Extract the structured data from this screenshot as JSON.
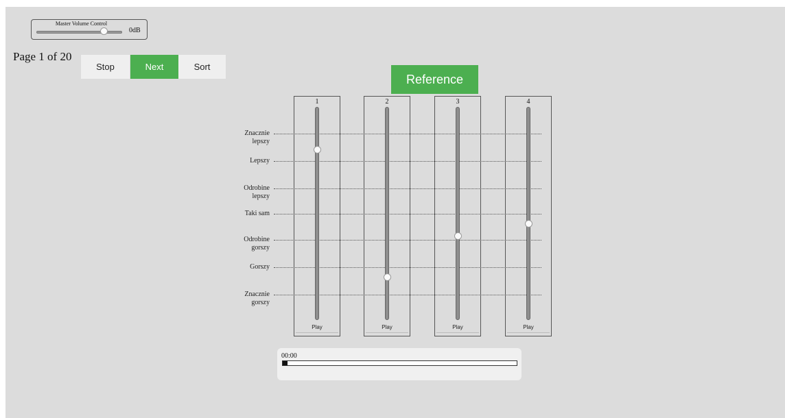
{
  "master_volume": {
    "title": "Master Volume Control",
    "value_label": "0dB",
    "level": 0.8
  },
  "pagination": {
    "label": "Page 1 of 20"
  },
  "buttons": {
    "stop": "Stop",
    "next": "Next",
    "sort": "Sort",
    "reference": "Reference"
  },
  "colors": {
    "accent": "#4caf50",
    "background": "#dcdcdc"
  },
  "scale_labels": [
    "Znacznie lepszy",
    "Lepszy",
    "Odrobine lepszy",
    "Taki sam",
    "Odrobine gorszy",
    "Gorszy",
    "Znacznie gorszy"
  ],
  "sliders": [
    {
      "number": "1",
      "play_label": "Play",
      "value": 0.81
    },
    {
      "number": "2",
      "play_label": "Play",
      "value": 0.19
    },
    {
      "number": "3",
      "play_label": "Play",
      "value": 0.39
    },
    {
      "number": "4",
      "play_label": "Play",
      "value": 0.45
    }
  ],
  "playback": {
    "time": "00:00",
    "progress": 0.02
  }
}
